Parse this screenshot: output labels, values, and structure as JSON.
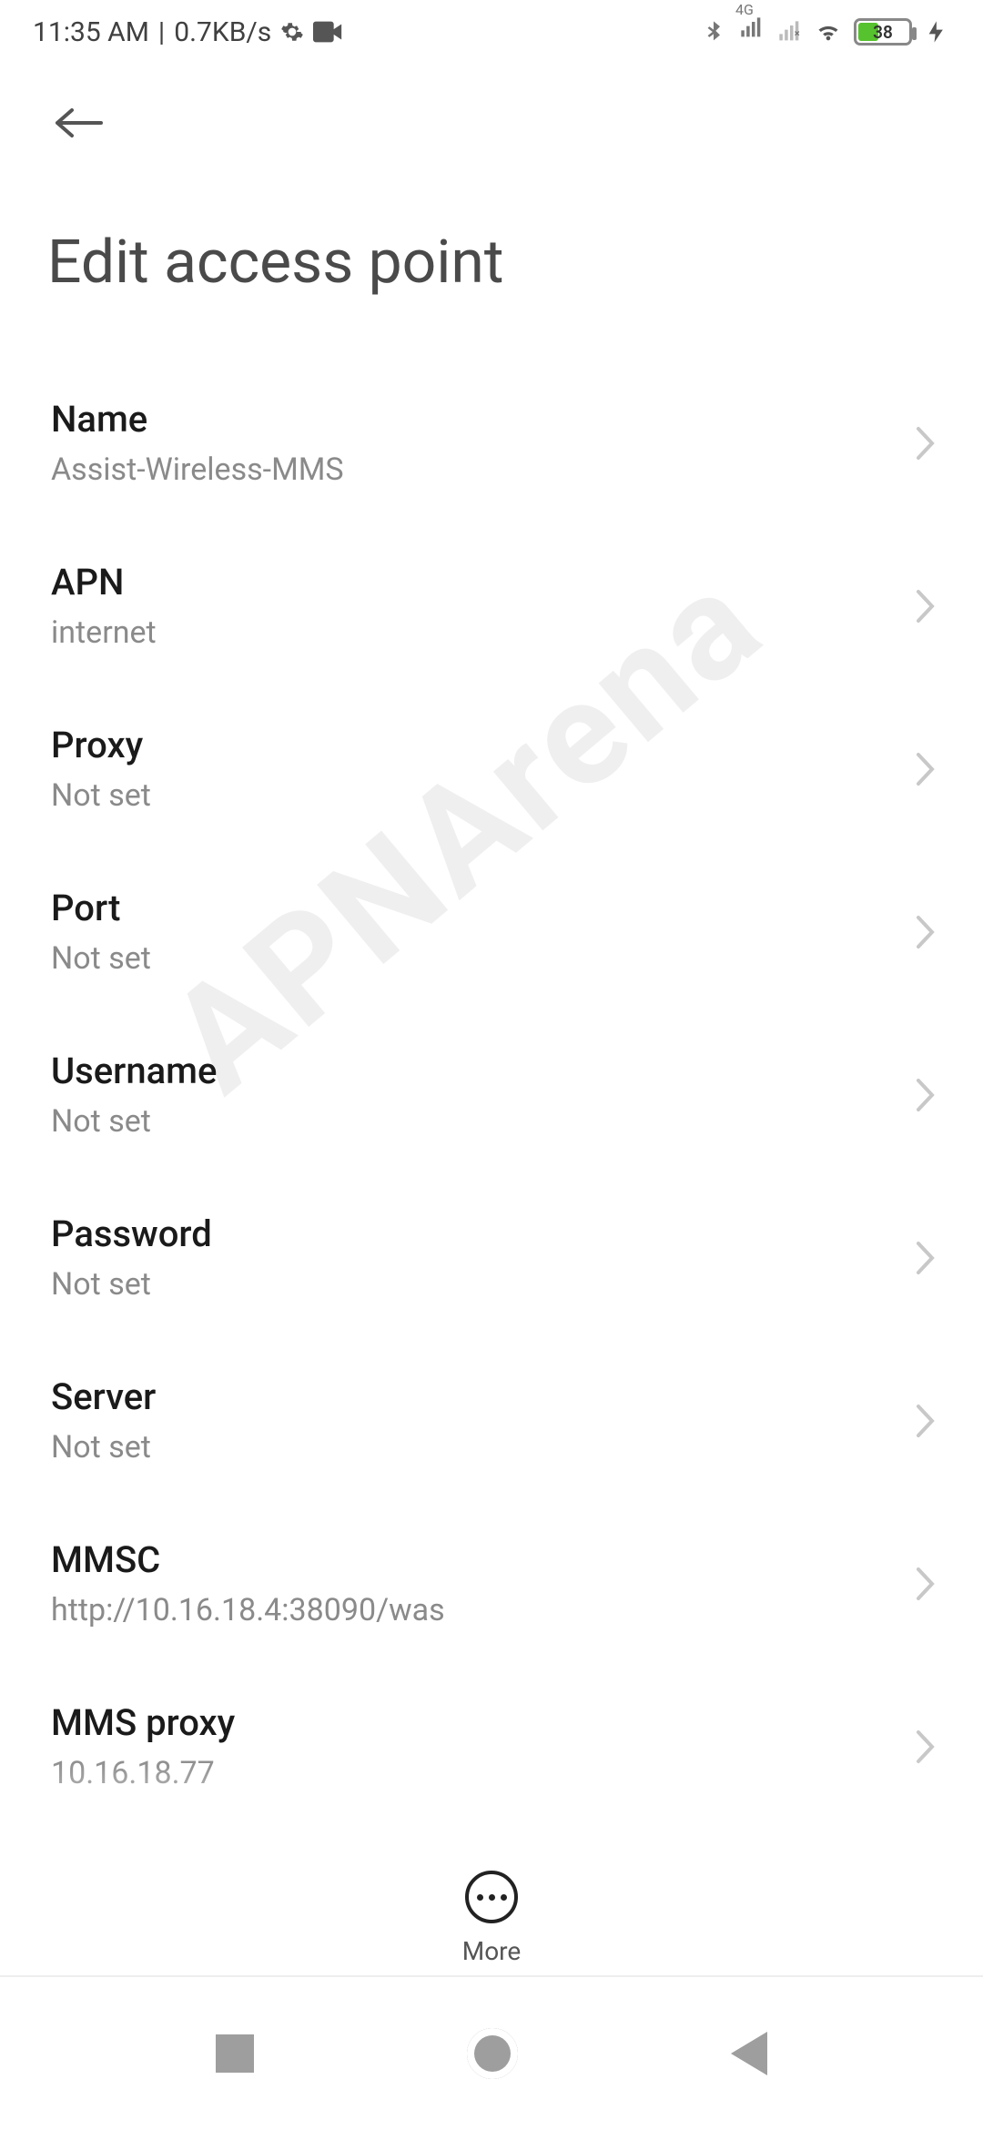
{
  "status": {
    "time": "11:35 AM",
    "sep": "|",
    "speed": "0.7KB/s",
    "network_type": "4G",
    "battery_pct": "38"
  },
  "header": {
    "title": "Edit access point"
  },
  "watermark": "APNArena",
  "rows": [
    {
      "label": "Name",
      "value": "Assist-Wireless-MMS"
    },
    {
      "label": "APN",
      "value": "internet"
    },
    {
      "label": "Proxy",
      "value": "Not set"
    },
    {
      "label": "Port",
      "value": "Not set"
    },
    {
      "label": "Username",
      "value": "Not set"
    },
    {
      "label": "Password",
      "value": "Not set"
    },
    {
      "label": "Server",
      "value": "Not set"
    },
    {
      "label": "MMSC",
      "value": "http://10.16.18.4:38090/was"
    },
    {
      "label": "MMS proxy",
      "value": "10.16.18.77"
    }
  ],
  "bottom": {
    "more": "More"
  }
}
